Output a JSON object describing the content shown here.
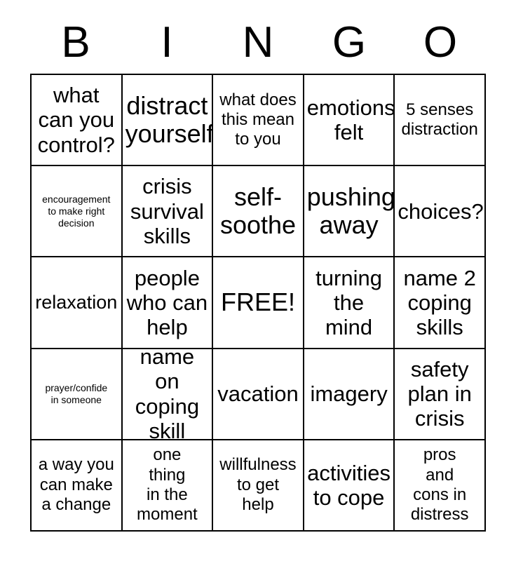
{
  "card": {
    "title_letters": [
      "B",
      "I",
      "N",
      "G",
      "O"
    ],
    "border_color": "#000000",
    "background_color": "#ffffff",
    "text_color": "#000000",
    "columns": 5,
    "rows": 5,
    "free_space_label": "FREE!",
    "free_space_position": {
      "row": 3,
      "column": 3
    }
  },
  "grid": [
    [
      {
        "text": "what\ncan you\ncontrol?",
        "size": "xl"
      },
      {
        "text": "distract\nyourself",
        "size": "xxl"
      },
      {
        "text": "what does\nthis mean\nto you",
        "size": "md"
      },
      {
        "text": "emotions\nfelt",
        "size": "xl"
      },
      {
        "text": "5 senses\ndistraction",
        "size": "md"
      }
    ],
    [
      {
        "text": "encouragement\nto make right\ndecision",
        "size": "xs"
      },
      {
        "text": "crisis\nsurvival\nskills",
        "size": "xl"
      },
      {
        "text": "self-\nsoothe",
        "size": "xxl"
      },
      {
        "text": "pushing\naway",
        "size": "xxl"
      },
      {
        "text": "choices?",
        "size": "xl"
      }
    ],
    [
      {
        "text": "relaxation",
        "size": "lg"
      },
      {
        "text": "people\nwho can\nhelp",
        "size": "xl"
      },
      {
        "text": "FREE!",
        "size": "xxl"
      },
      {
        "text": "turning\nthe\nmind",
        "size": "xl"
      },
      {
        "text": "name 2\ncoping\nskills",
        "size": "xl"
      }
    ],
    [
      {
        "text": "prayer/confide\nin someone",
        "size": "xs"
      },
      {
        "text": "name on\ncoping\nskill",
        "size": "xl"
      },
      {
        "text": "vacation",
        "size": "xl"
      },
      {
        "text": "imagery",
        "size": "xl"
      },
      {
        "text": "safety\nplan in\ncrisis",
        "size": "xl"
      }
    ],
    [
      {
        "text": "a way you\ncan make\na change",
        "size": "md"
      },
      {
        "text": "one\nthing\nin the\nmoment",
        "size": "md"
      },
      {
        "text": "willfulness\nto get\nhelp",
        "size": "md"
      },
      {
        "text": "activities\nto cope",
        "size": "xl"
      },
      {
        "text": "pros\nand\ncons in\ndistress",
        "size": "md"
      }
    ]
  ]
}
